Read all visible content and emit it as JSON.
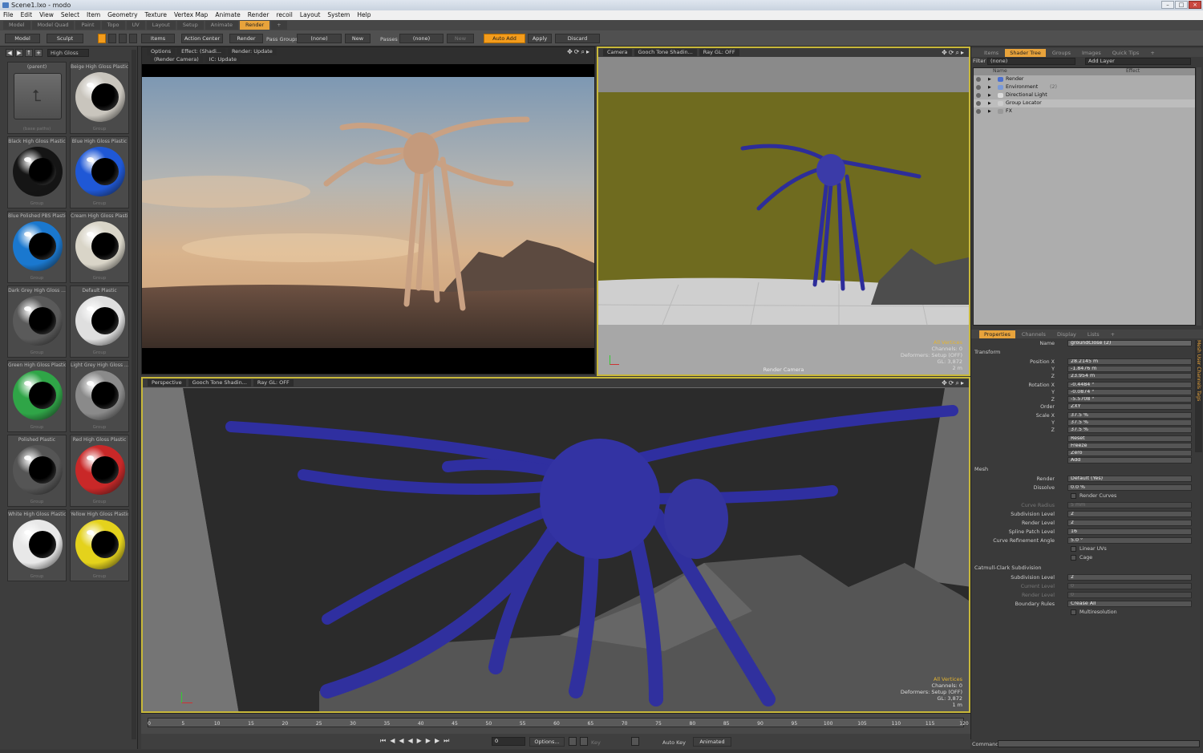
{
  "title": "Scene1.lxo - modo",
  "menu": [
    "File",
    "Edit",
    "View",
    "Select",
    "Item",
    "Geometry",
    "Texture",
    "Vertex Map",
    "Animate",
    "Render",
    "recoil",
    "Layout",
    "System",
    "Help"
  ],
  "layouts": [
    "Model",
    "Model Quad",
    "Paint",
    "Topo",
    "UV",
    "Layout",
    "Setup",
    "Animate",
    "Render",
    "+"
  ],
  "toolbar": {
    "model": "Model",
    "sculpt": "Sculpt",
    "items": "Items",
    "action_center": "Action Center",
    "render": "Render",
    "pass_groups": "Pass Groups",
    "pass_groups_value": "(none)",
    "new": "New",
    "passes": "Passes",
    "passes_value": "(none)",
    "new2": "New",
    "auto_add": "Auto Add",
    "apply": "Apply",
    "discard": "Discard"
  },
  "library": {
    "filter": "High Gloss",
    "items": [
      {
        "label": "(parent)",
        "sub": "(base paths)",
        "type": "folder"
      },
      {
        "label": "Beige High Gloss Plastic",
        "sub": "Group",
        "color": "#c9c5bd"
      },
      {
        "label": "Black High Gloss Plastic",
        "sub": "Group",
        "color": "#151515"
      },
      {
        "label": "Blue High Gloss Plastic",
        "sub": "Group",
        "color": "#1f58d6"
      },
      {
        "label": "Blue Polished PBS Plastic",
        "sub": "Group",
        "color": "#1a78cf"
      },
      {
        "label": "Cream High Gloss Plastic",
        "sub": "Group",
        "color": "#d9d5c8"
      },
      {
        "label": "Dark Grey High Gloss ...",
        "sub": "Group",
        "color": "#5a5a5a"
      },
      {
        "label": "Default Plastic",
        "sub": "Group",
        "color": "#dfdfdf"
      },
      {
        "label": "Green High Gloss Plastic",
        "sub": "Group",
        "color": "#2fa547"
      },
      {
        "label": "Light Grey High Gloss ...",
        "sub": "Group",
        "color": "#8a8a8a"
      },
      {
        "label": "Polished Plastic",
        "sub": "Group",
        "color": "#555555"
      },
      {
        "label": "Red High Gloss Plastic",
        "sub": "Group",
        "color": "#c92828"
      },
      {
        "label": "White High Gloss Plastic",
        "sub": "Group",
        "color": "#e8e8e8"
      },
      {
        "label": "Yellow High Gloss Plastic",
        "sub": "Group",
        "color": "#e4d21c"
      }
    ]
  },
  "render_view": {
    "options": "Options",
    "effect": "Effect: (Shadi...",
    "render": "Render: Update",
    "camera": "(Render Camera)",
    "ic": "IC: Update"
  },
  "camera_view": {
    "tab1": "Camera",
    "tab2": "Gooch Tone Shadin...",
    "tab3": "Ray GL: OFF",
    "label": "Render Camera",
    "info": [
      "All Vertices",
      "Channels: 0",
      "Deformers: Setup (OFF)",
      "GL: 3,872",
      "2 m"
    ]
  },
  "persp_view": {
    "tab1": "Perspective",
    "tab2": "Gooch Tone Shadin...",
    "tab3": "Ray GL: OFF",
    "info": [
      "All Vertices",
      "Channels: 0",
      "Deformers: Setup (OFF)",
      "GL: 3,872",
      "1 m"
    ]
  },
  "shader": {
    "tabs": [
      "Items",
      "Shader Tree",
      "Groups",
      "Images",
      "Quick Tips",
      "+"
    ],
    "filter_label": "Filter",
    "filter_value": "(none)",
    "add_layer": "Add Layer",
    "col_name": "Name",
    "col_effect": "Effect",
    "rows": [
      {
        "name": "Render",
        "extra": ""
      },
      {
        "name": "Environment",
        "extra": "(2)"
      },
      {
        "name": "Directional Light",
        "extra": ""
      },
      {
        "name": "Group Locator",
        "extra": ""
      },
      {
        "name": "FX",
        "extra": ""
      }
    ]
  },
  "properties": {
    "tabs": [
      "Properties",
      "Channels",
      "Display",
      "Lists",
      "+"
    ],
    "name_label": "Name",
    "name_value": "groundClose (2)",
    "transform": "Transform",
    "position_label": "Position X",
    "pos": [
      "28.2145 m",
      "-1.8476 m",
      "23.954 m"
    ],
    "rotation_label": "Rotation X",
    "rot": [
      "-0.4484 °",
      "-0.0874 °",
      "-5.5708 °"
    ],
    "order_label": "Order",
    "order": "ZXY",
    "scale_label": "Scale X",
    "scale": [
      "37.5 %",
      "37.5 %",
      "37.5 %"
    ],
    "actions": [
      "Reset",
      "Freeze",
      "Zero",
      "Add"
    ],
    "axes": [
      "Y",
      "Z"
    ],
    "mesh": "Mesh",
    "render_label": "Render",
    "render_value": "Default (Yes)",
    "dissolve_label": "Dissolve",
    "dissolve_value": "0.0 %",
    "render_curves": "Render Curves",
    "curve_radius": "Curve Radius",
    "curve_radius_value": "5 mm",
    "subdiv_label": "Subdivision Level",
    "subdiv_value": "2",
    "render_level": "Render Level",
    "render_level_value": "2",
    "spline_label": "Spline Patch Level",
    "spline_value": "16",
    "curve_ref": "Curve Refinement Angle",
    "curve_ref_value": "5.0 °",
    "linear_uvs": "Linear UVs",
    "cage": "Cage",
    "catmull": "Catmull-Clark Subdivision",
    "cc_subdiv": "Subdivision Level",
    "cc_subdiv_value": "2",
    "cc_current": "Current Level",
    "cc_current_value": "0",
    "cc_render": "Render Level",
    "cc_render_value": "0",
    "boundary": "Boundary Rules",
    "boundary_value": "Crease All",
    "multires": "Multiresolution",
    "side_tabs": "Mesh  User Channels  Tags"
  },
  "timeline": {
    "ticks": [
      "0",
      "5",
      "10",
      "15",
      "20",
      "25",
      "30",
      "35",
      "40",
      "45",
      "50",
      "55",
      "60",
      "65",
      "70",
      "75",
      "80",
      "85",
      "90",
      "95",
      "100",
      "105",
      "110",
      "115",
      "120"
    ]
  },
  "transport": {
    "frame": "0",
    "options": "Options...",
    "key": "Key",
    "auto_key": "Auto Key",
    "animated": "Animated"
  },
  "command": "Command"
}
